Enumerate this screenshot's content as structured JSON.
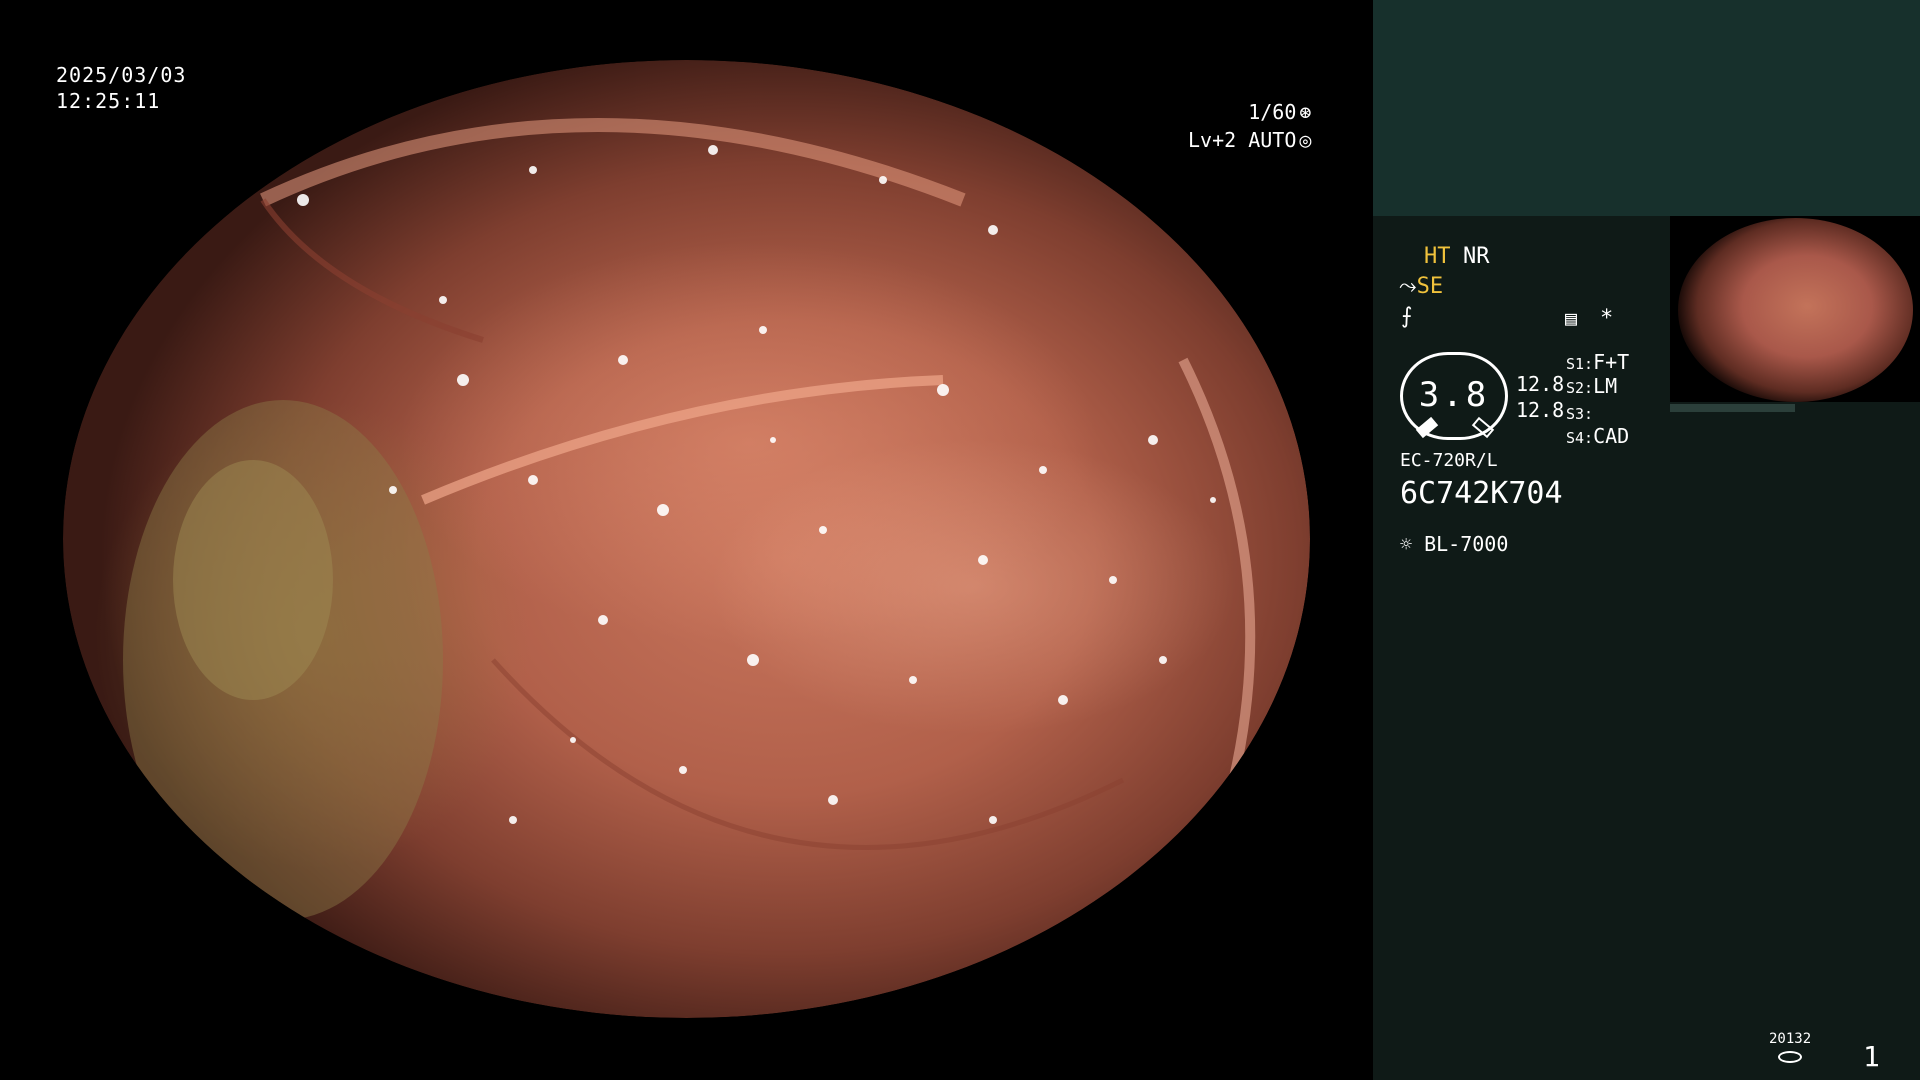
{
  "overlay": {
    "date": "2025/03/03",
    "time": "12:25:11",
    "shutter": "1/60",
    "level": "Lv+2",
    "mode": "AUTO",
    "shutter_icon": "aperture-icon",
    "mode_icon": "iris-icon"
  },
  "panel": {
    "mode1": "HT",
    "mode2": "NR",
    "mode3": "SE",
    "freeze_icon": "freeze-symbol-icon",
    "menu_icon": "panel-menu-icon",
    "asterisk": "*",
    "gauge_value": "3.8",
    "zoom1": "12.8",
    "zoom2": "12.8",
    "s_buttons": [
      {
        "key": "S1:",
        "value": "F+T"
      },
      {
        "key": "S2:",
        "value": "LM"
      },
      {
        "key": "S3:",
        "value": ""
      },
      {
        "key": "S4:",
        "value": "CAD"
      }
    ],
    "scope_model": "EC-720R/L",
    "serial": "6C742K704",
    "light_source": "BL-7000",
    "counter": "20132",
    "page": "1"
  },
  "colors": {
    "panel_bg": "#0f1a17",
    "panel_header": "#17302c",
    "accent_yellow": "#f0c23c",
    "tissue": "#c8755c"
  }
}
